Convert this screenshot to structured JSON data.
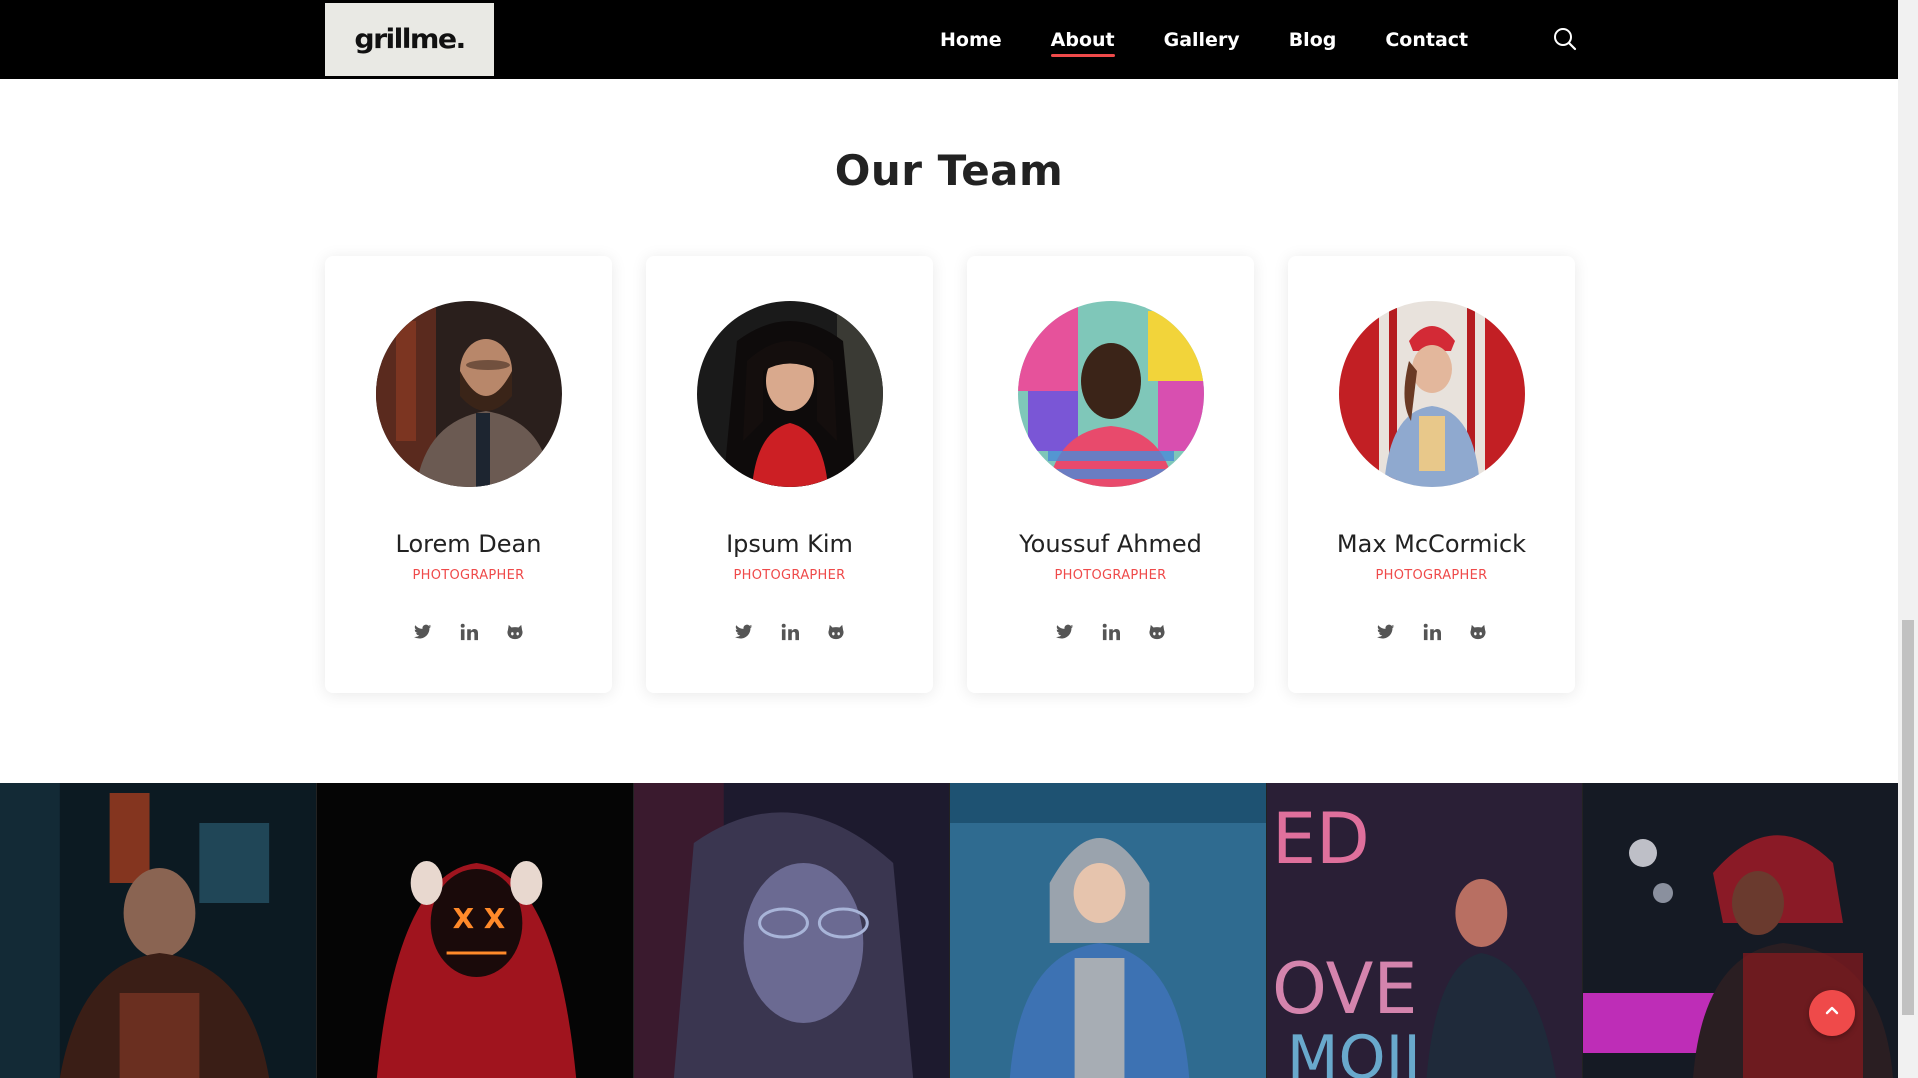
{
  "brand": {
    "logo_text": "grillme."
  },
  "nav": {
    "items": [
      {
        "label": "Home",
        "active": false
      },
      {
        "label": "About",
        "active": true
      },
      {
        "label": "Gallery",
        "active": false
      },
      {
        "label": "Blog",
        "active": false
      },
      {
        "label": "Contact",
        "active": false
      }
    ],
    "search_icon": "search-icon"
  },
  "section": {
    "title": "Our Team"
  },
  "team": [
    {
      "name": "Lorem Dean",
      "role": "PHOTOGRAPHER"
    },
    {
      "name": "Ipsum Kim",
      "role": "PHOTOGRAPHER"
    },
    {
      "name": "Youssuf Ahmed",
      "role": "PHOTOGRAPHER"
    },
    {
      "name": "Max McCormick",
      "role": "PHOTOGRAPHER"
    }
  ],
  "social_icons": [
    "twitter-icon",
    "linkedin-icon",
    "github-icon"
  ],
  "gallery_count": 6,
  "colors": {
    "accent": "#ef4a4a",
    "header_bg": "#000000",
    "logo_bg": "#e9e9e4"
  },
  "back_to_top_icon": "chevron-up-icon"
}
